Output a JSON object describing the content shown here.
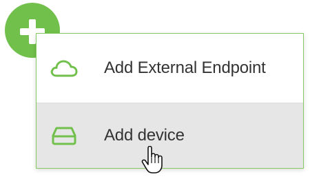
{
  "fab": {
    "icon": "plus-icon",
    "color": "#72c04c"
  },
  "menu": {
    "border_color": "#86c963",
    "hover_background": "#e6e6e6",
    "items": [
      {
        "label": "Add External Endpoint",
        "icon": "cloud-icon",
        "hovered": false
      },
      {
        "label": "Add device",
        "icon": "storage-device-icon",
        "hovered": true
      }
    ]
  },
  "cursor": {
    "type": "hand-pointer"
  }
}
